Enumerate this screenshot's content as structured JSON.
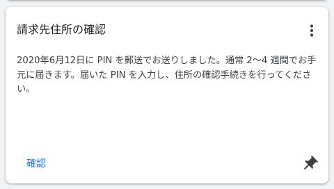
{
  "card": {
    "title": "請求先住所の確認",
    "body": "2020年6月12日に PIN を郵送でお送りしました。通常 2〜4 週間でお手元に届きます。届いた PIN を入力し、住所の確認手続きを行ってください。",
    "action_label": "確認"
  },
  "icons": {
    "more": "more-vert-icon",
    "pin": "push-pin-icon"
  },
  "colors": {
    "accent": "#1a73e8",
    "icon": "#3c4043",
    "title_text": "#202124",
    "body_text": "#3c4043",
    "background": "#f1f3f4"
  }
}
